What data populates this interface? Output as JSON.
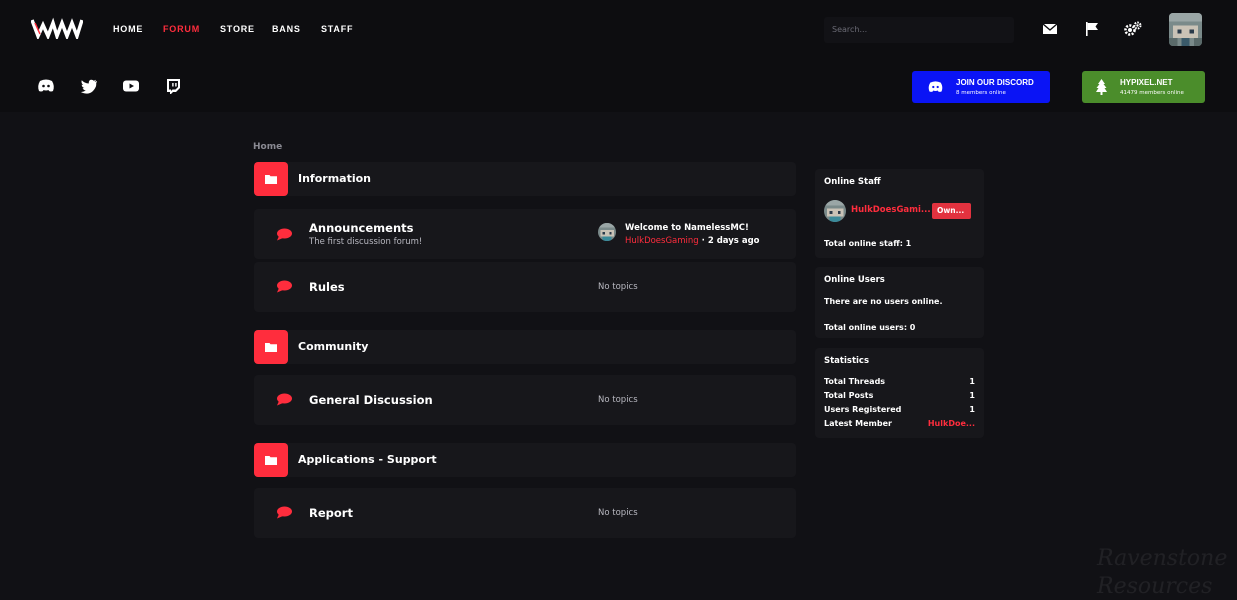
{
  "nav": {
    "links": [
      {
        "label": "HOME",
        "active": false
      },
      {
        "label": "FORUM",
        "active": true
      },
      {
        "label": "STORE",
        "active": false
      },
      {
        "label": "BANS",
        "active": false
      },
      {
        "label": "STAFF",
        "active": false
      }
    ],
    "search_placeholder": "Search...",
    "icons": [
      "mail-icon",
      "flag-icon",
      "gears-icon",
      "user-avatar"
    ]
  },
  "subnav": {
    "socials": [
      "discord-icon",
      "twitter-icon",
      "youtube-icon",
      "twitch-icon"
    ],
    "discord": {
      "title": "JOIN OUR DISCORD",
      "subtitle": "8 members online"
    },
    "server": {
      "title": "HYPIXEL.NET",
      "subtitle": "41479 members online"
    }
  },
  "breadcrumb": "Home",
  "categories": [
    {
      "title": "Information",
      "forums": [
        {
          "title": "Announcements",
          "description": "The first discussion forum!",
          "latest": {
            "title": "Welcome to NamelessMC!",
            "user": "HulkDoesGaming",
            "time": " · 2 days ago"
          }
        },
        {
          "title": "Rules",
          "no_topics": "No topics"
        }
      ]
    },
    {
      "title": "Community",
      "forums": [
        {
          "title": "General Discussion",
          "no_topics": "No topics"
        }
      ]
    },
    {
      "title": "Applications - Support",
      "forums": [
        {
          "title": "Report",
          "no_topics": "No topics"
        }
      ]
    }
  ],
  "sidebar": {
    "online_staff": {
      "title": "Online Staff",
      "user": "HulkDoesGami...",
      "badge": "Own...",
      "total": "Total online staff: 1"
    },
    "online_users": {
      "title": "Online Users",
      "message": "There are no users online.",
      "total": "Total online users: 0"
    },
    "statistics": {
      "title": "Statistics",
      "rows": [
        {
          "label": "Total Threads",
          "value": "1"
        },
        {
          "label": "Total Posts",
          "value": "1"
        },
        {
          "label": "Users Registered",
          "value": "1"
        },
        {
          "label": "Latest Member",
          "value": "HulkDoe..."
        }
      ]
    }
  },
  "watermark": [
    "Ravenstone",
    "Resources"
  ],
  "colors": {
    "accent": "#ff2d3d",
    "discord": "#0a14f5",
    "server": "#4b8d2b",
    "background": "#111115"
  }
}
